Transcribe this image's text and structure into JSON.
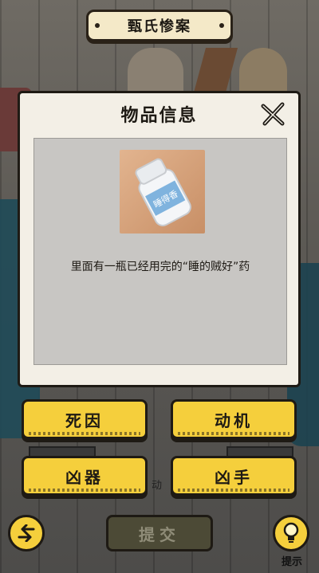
{
  "header": {
    "title": "甄氏惨案"
  },
  "modal": {
    "title": "物品信息",
    "item_label": "睡得香",
    "description": "里面有一瓶已经用完的“睡的贼好”药"
  },
  "options": [
    {
      "label": "死因"
    },
    {
      "label": "动机"
    },
    {
      "label": "凶器"
    },
    {
      "label": "凶手"
    }
  ],
  "controls": {
    "submit_label": "提交",
    "hint_label": "提示",
    "back_icon": "back-arrow-icon",
    "hint_icon": "lightbulb-icon"
  },
  "background": {
    "partial_text": "动"
  },
  "colors": {
    "accent_yellow": "#f5cf3c",
    "outline": "#1e1a14",
    "modal_bg": "#f3efe6",
    "panel_bg": "#c8c6c3"
  }
}
